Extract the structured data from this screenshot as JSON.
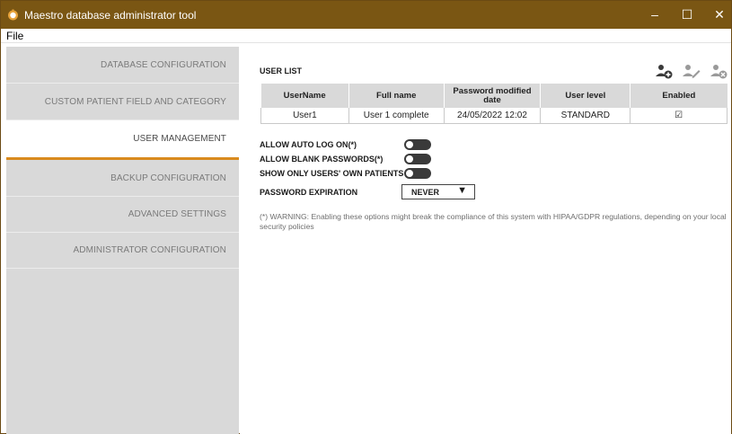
{
  "window": {
    "title": "Maestro database administrator tool",
    "controls": {
      "minimize": "–",
      "maximize": "☐",
      "close": "✕"
    }
  },
  "menu": {
    "file": "File"
  },
  "sidebar": {
    "items": [
      {
        "label": "DATABASE CONFIGURATION",
        "active": false
      },
      {
        "label": "CUSTOM PATIENT FIELD AND CATEGORY MANAGEMENT",
        "active": false
      },
      {
        "label": "USER MANAGEMENT",
        "active": true
      },
      {
        "label": "BACKUP CONFIGURATION",
        "active": false
      },
      {
        "label": "ADVANCED SETTINGS",
        "active": false
      },
      {
        "label": "ADMINISTRATOR CONFIGURATION",
        "active": false
      }
    ]
  },
  "user_list": {
    "title": "USER LIST",
    "toolbar": {
      "add": "add-user-icon",
      "edit": "edit-user-icon",
      "remove": "remove-user-icon"
    },
    "columns": [
      "UserName",
      "Full name",
      "Password modified date",
      "User level",
      "Enabled"
    ],
    "rows": [
      {
        "username": "User1",
        "full_name": "User 1 complete",
        "password_modified": "24/05/2022 12:02",
        "user_level": "STANDARD",
        "enabled": "☑"
      }
    ]
  },
  "options": {
    "auto_log_on": "ALLOW AUTO LOG ON(*)",
    "blank_passwords": "ALLOW BLANK PASSWORDS(*)",
    "own_patients": "SHOW ONLY USERS' OWN PATIENTS",
    "password_expiration": "PASSWORD EXPIRATION",
    "password_expiration_value": "NEVER",
    "dropdown_arrow": "▼"
  },
  "warning": "(*) WARNING: Enabling these options might break the compliance of this system with HIPAA/GDPR regulations, depending on your local security policies",
  "colors": {
    "titlebar": "#7a5613",
    "accent": "#d98a1e",
    "sidebar": "#d9d9d9",
    "toggle": "#3a3a3a"
  }
}
